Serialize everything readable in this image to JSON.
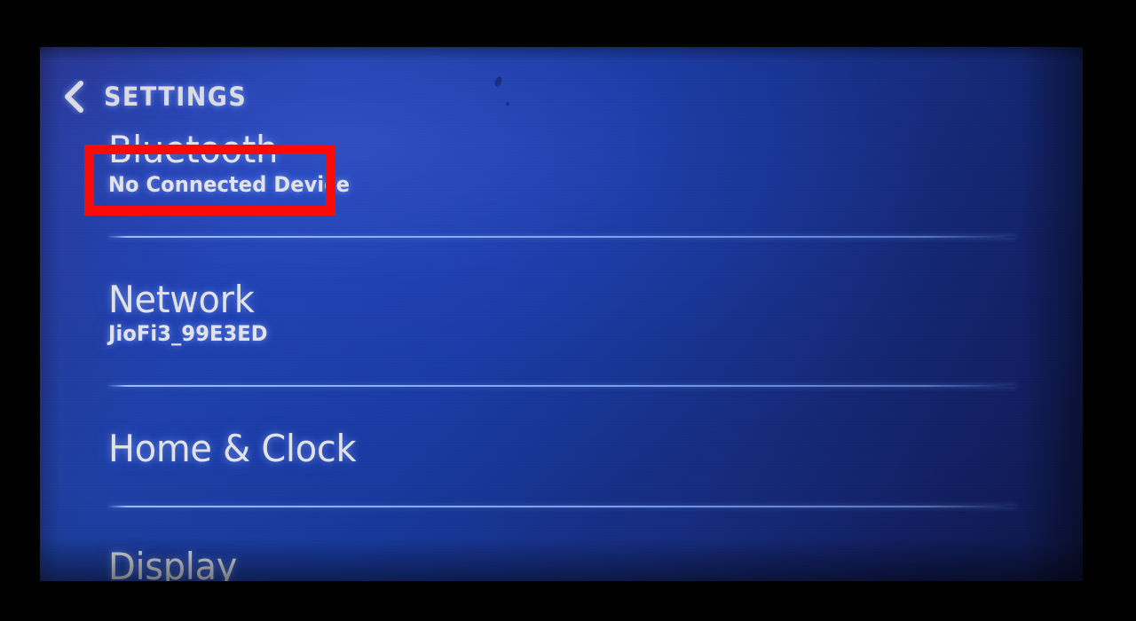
{
  "device": {
    "screen_label": "infotainment-settings-screen"
  },
  "header": {
    "back_icon": "chevron-left-icon",
    "title": "SETTINGS"
  },
  "settings": {
    "rows": [
      {
        "title": "Bluetooth",
        "subtitle": "No Connected Device",
        "highlighted": true
      },
      {
        "title": "Network",
        "subtitle": "JioFi3_99E3ED",
        "highlighted": false
      },
      {
        "title": "Home & Clock",
        "subtitle": "",
        "highlighted": false
      },
      {
        "title": "Display",
        "subtitle": "",
        "highlighted": false
      }
    ]
  },
  "annotation": {
    "type": "highlight-rectangle",
    "target": "Bluetooth",
    "color": "#fb0a0a"
  },
  "colors": {
    "screen_blue_light": "#1d3fa4",
    "screen_blue_dark": "#0f1a52",
    "text_primary": "#e2e3e8",
    "divider": "#a8c8ff",
    "bezel": "#000000",
    "annotation_red": "#fb0a0a"
  }
}
